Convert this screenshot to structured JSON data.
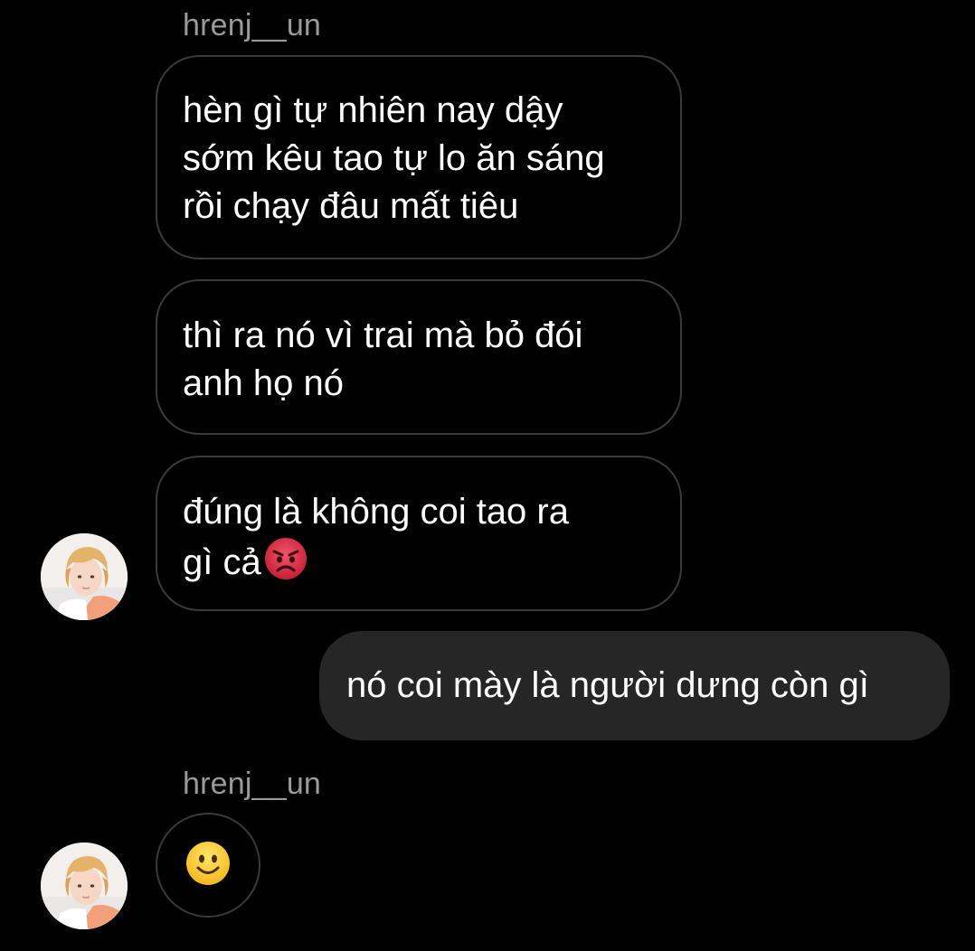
{
  "thread": {
    "messages": [
      {
        "sender": "hrenj__un",
        "direction": "received",
        "lines": [
          "hèn gì tự nhiên nay dậy",
          "sớm kêu tao tự lo ăn sáng",
          "rồi chạy đâu mất tiêu"
        ]
      },
      {
        "sender": "hrenj__un",
        "direction": "received",
        "lines": [
          "thì ra nó vì trai mà bỏ đói",
          "anh họ nó"
        ]
      },
      {
        "sender": "hrenj__un",
        "direction": "received",
        "lines": [
          "đúng là không coi tao ra",
          "gì cả"
        ],
        "trailing_emoji": "angry-face-icon"
      },
      {
        "sender": "me",
        "direction": "sent",
        "lines": [
          "nó coi mày là người dưng còn gì"
        ]
      },
      {
        "sender": "hrenj__un",
        "direction": "received",
        "emoji_only": "slightly-smiling-face-icon"
      }
    ]
  },
  "colors": {
    "background": "#000000",
    "sender_name": "#9a9a9a",
    "received_border": "#3a3a3a",
    "sent_bubble": "#262626",
    "text": "#ffffff"
  }
}
